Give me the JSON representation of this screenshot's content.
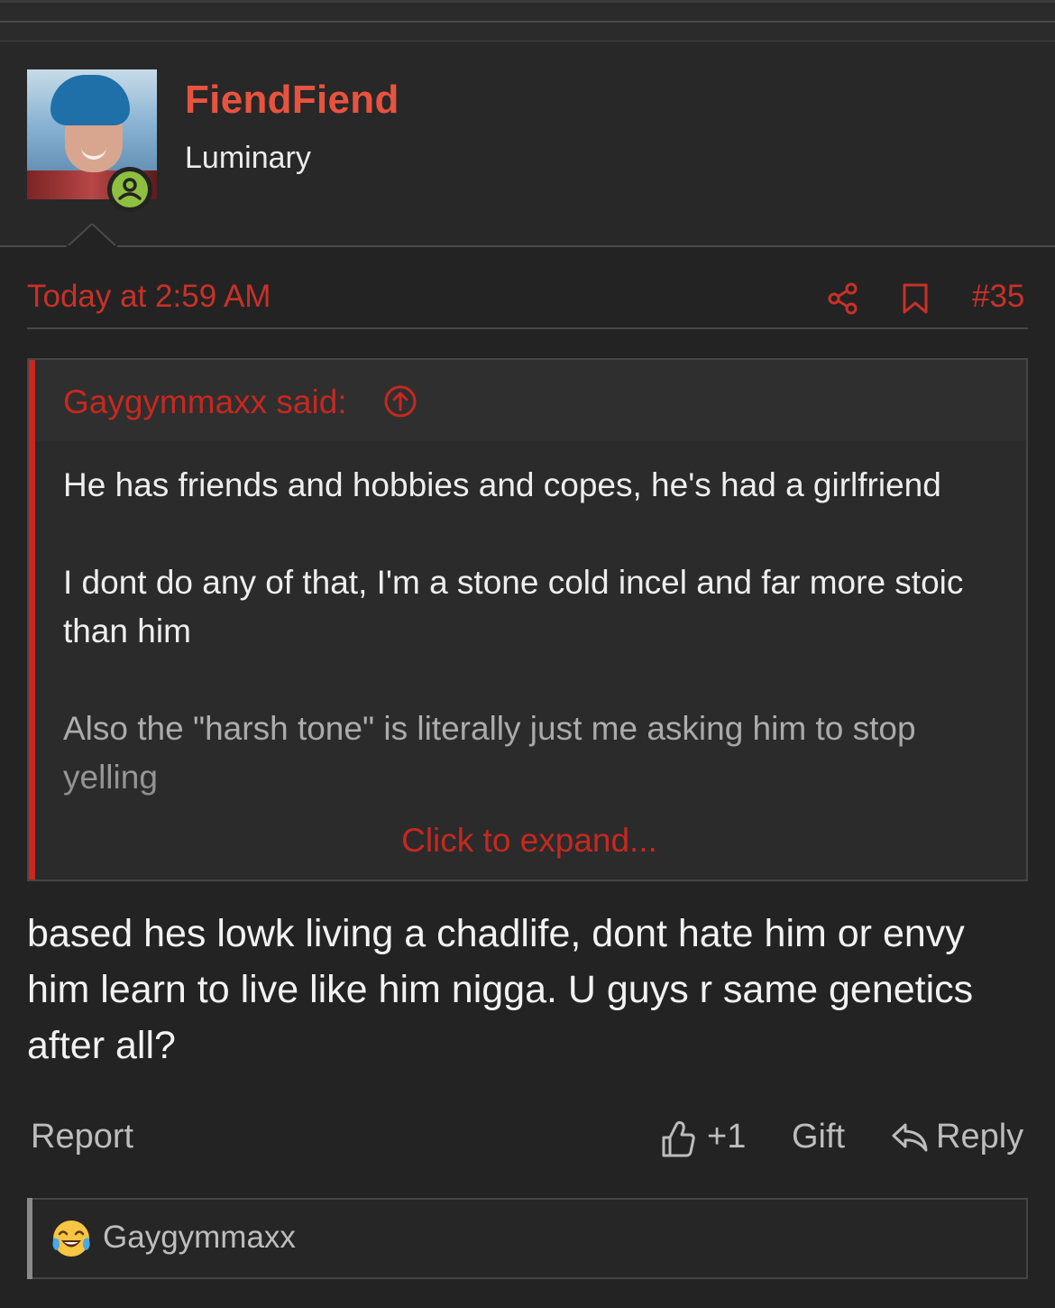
{
  "post": {
    "author": {
      "username": "FiendFiend",
      "title": "Luminary",
      "online": true
    },
    "timestamp": "Today at 2:59 AM",
    "post_number": "#35",
    "quote": {
      "author_label": "Gaygymmaxx said:",
      "paragraphs": [
        "He has friends and hobbies and copes, he's had a girlfriend",
        "I dont do any of that, I'm a stone cold incel and far more stoic than him",
        "Also the \"harsh tone\" is literally just me asking him to stop yelling"
      ],
      "expand_label": "Click to expand..."
    },
    "body": "based hes lowk living a chadlife, dont hate him or envy him learn to live like him nigga. U guys r same genetics after all?",
    "actions": {
      "report": "Report",
      "like_count": "+1",
      "gift": "Gift",
      "reply": "Reply"
    },
    "reactions": {
      "emoji": "crying-laughing-emoji",
      "users": "Gaygymmaxx"
    }
  },
  "colors": {
    "accent": "#c7281f",
    "username": "#e8533f",
    "background": "#232323",
    "online": "#8ebf3e"
  }
}
